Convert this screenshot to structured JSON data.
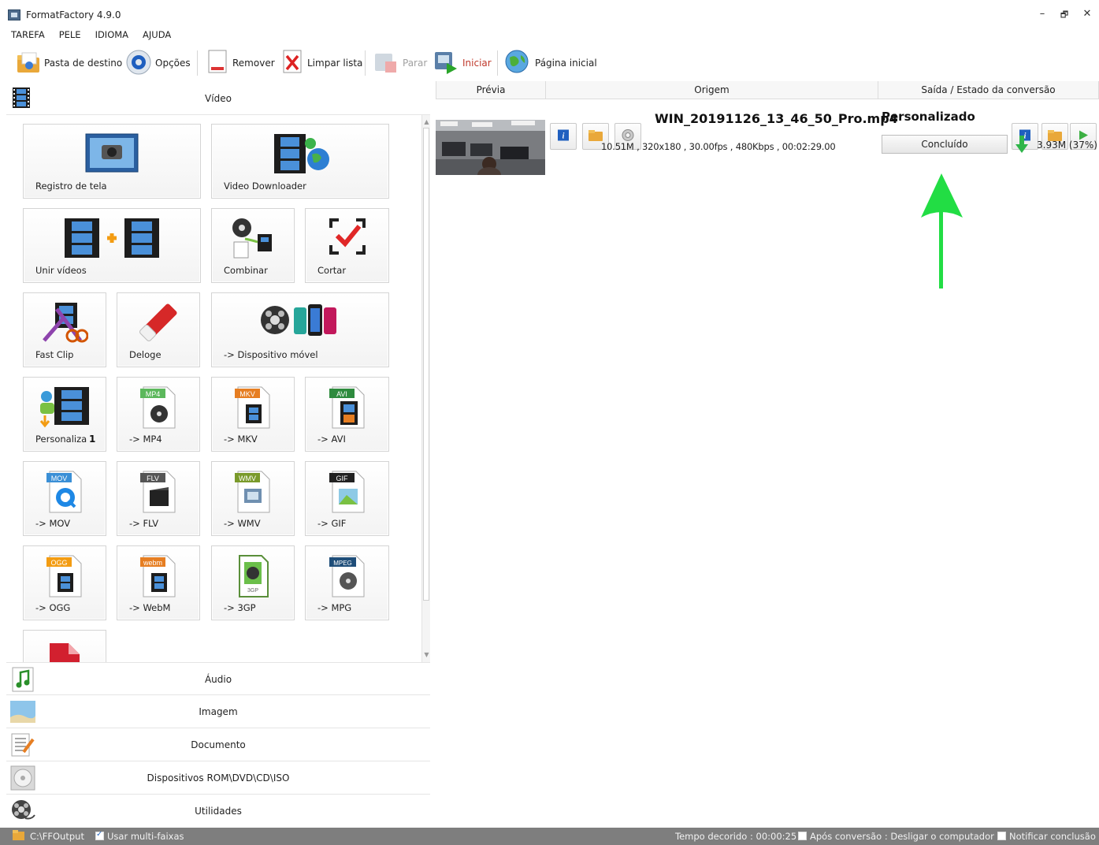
{
  "window": {
    "title": "FormatFactory 4.9.0",
    "controls": {
      "minimize": "–",
      "restore": "🗗",
      "close": "✕"
    }
  },
  "menu": [
    "TAREFA",
    "PELE",
    "IDIOMA",
    "AJUDA"
  ],
  "toolbar": {
    "destination_label": "Pasta de destino",
    "options_label": "Opções",
    "remove_label": "Remover",
    "clear_label": "Limpar lista",
    "stop_label": "Parar",
    "start_label": "Iniciar",
    "home_label": "Página inicial"
  },
  "left_panel": {
    "video_category": "Vídeo",
    "tiles": {
      "screen_record": "Registro de tela",
      "video_downloader": "Video Downloader",
      "join_videos": "Unir vídeos",
      "combine": "Combinar",
      "cut": "Cortar",
      "fast_clip": "Fast Clip",
      "delogo": "Deloge",
      "mobile": "-> Dispositivo móvel",
      "custom": "Personaliza",
      "custom_badge": "1",
      "mp4": "-> MP4",
      "mkv": "-> MKV",
      "avi": "-> AVI",
      "mov": "-> MOV",
      "flv": "-> FLV",
      "wmv": "-> WMV",
      "gif": "-> GIF",
      "ogg": "-> OGG",
      "webm": "-> WebM",
      "3gp": "-> 3GP",
      "mpg": "-> MPG"
    },
    "file_tags": {
      "mp4": "MP4",
      "mkv": "MKV",
      "avi": "AVI",
      "mov": "MOV",
      "flv": "FLV",
      "wmv": "WMV",
      "gif": "GIF",
      "ogg": "OGG",
      "webm": "webm",
      "3gp": "3GP",
      "mpg": "MPEG"
    },
    "categories": {
      "audio": "Áudio",
      "image": "Imagem",
      "document": "Documento",
      "rom": "Dispositivos ROM\\DVD\\CD\\ISO",
      "utilities": "Utilidades"
    }
  },
  "task_list": {
    "headers": {
      "preview": "Prévia",
      "source": "Origem",
      "output": "Saída / Estado da conversão"
    },
    "job": {
      "filename": "WIN_20191126_13_46_50_Pro.mp4",
      "details": "10.51M , 320x180 , 30.00fps , 480Kbps , 00:02:29.00",
      "output_profile": "Personalizado",
      "status": "Concluído",
      "output_size": "3.93M",
      "output_percent": "(37%)"
    }
  },
  "statusbar": {
    "output_path": "C:\\FFOutput",
    "multithread_label": "Usar multi-faixas",
    "multithread_checked": true,
    "elapsed": "Tempo decorido : 00:00:25",
    "after_conversion_label": "Após conversão : Desligar o computador",
    "after_conversion_checked": false,
    "notify_label": "Notificar conclusão",
    "notify_checked": false
  },
  "colors": {
    "accent_blue": "#2b6cc4",
    "arrow_green": "#22dd44",
    "statusbar_bg": "#7e7e7e",
    "start_red": "#c0392b"
  }
}
